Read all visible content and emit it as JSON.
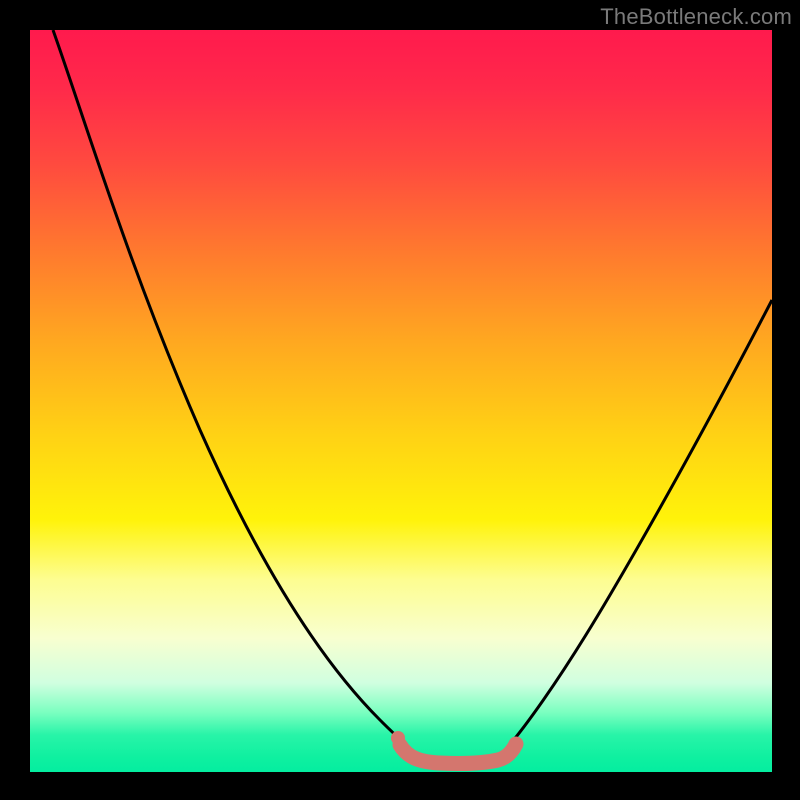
{
  "watermark": "TheBottleneck.com",
  "chart_data": {
    "type": "line",
    "title": "",
    "xlabel": "",
    "ylabel": "",
    "xlim": [
      0,
      100
    ],
    "ylim": [
      0,
      100
    ],
    "series": [
      {
        "name": "left-curve",
        "x": [
          3,
          10,
          18,
          26,
          33,
          39,
          44,
          48,
          50.5,
          52
        ],
        "y": [
          100,
          82,
          64,
          47,
          32,
          20,
          11,
          5,
          2,
          0.5
        ]
      },
      {
        "name": "right-curve",
        "x": [
          63,
          67,
          72,
          78,
          84,
          90,
          96,
          100
        ],
        "y": [
          0.5,
          4,
          10,
          20,
          32,
          44,
          56,
          66
        ]
      },
      {
        "name": "bottom-band",
        "x": [
          50,
          52,
          55,
          58,
          61,
          64,
          66
        ],
        "y": [
          2,
          0.5,
          0.5,
          0.5,
          0.5,
          1,
          2.5
        ]
      }
    ],
    "colors": {
      "curve": "#000000",
      "band": "#d4766e",
      "dot": "#d4766e"
    }
  }
}
